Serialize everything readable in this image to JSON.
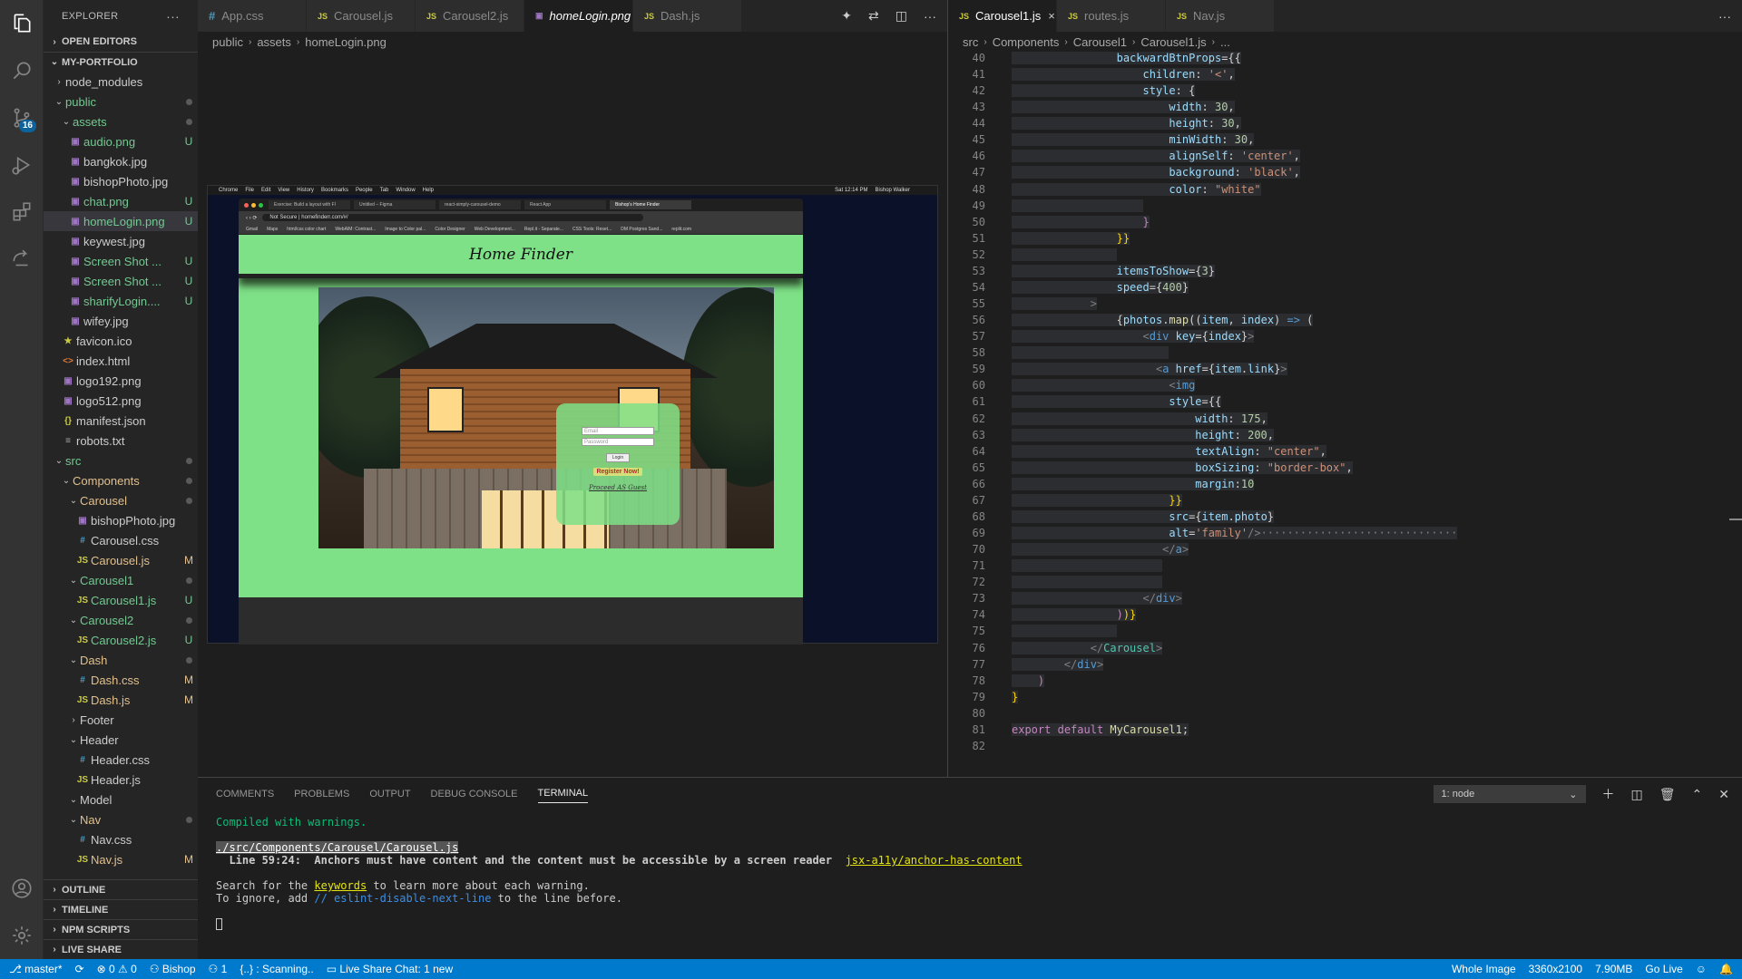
{
  "sidebar": {
    "title": "EXPLORER",
    "more": "···",
    "open_editors": "OPEN EDITORS",
    "project": "MY-PORTFOLIO",
    "tree": [
      {
        "depth": 1,
        "kind": "folder",
        "open": false,
        "label": "node_modules",
        "status": ""
      },
      {
        "depth": 1,
        "kind": "folder",
        "open": true,
        "label": "public",
        "status": "dot",
        "color": "green"
      },
      {
        "depth": 2,
        "kind": "folder",
        "open": true,
        "label": "assets",
        "status": "dot",
        "color": "green"
      },
      {
        "depth": 3,
        "kind": "img",
        "label": "audio.png",
        "status": "U",
        "color": "green"
      },
      {
        "depth": 3,
        "kind": "img",
        "label": "bangkok.jpg",
        "status": ""
      },
      {
        "depth": 3,
        "kind": "img",
        "label": "bishopPhoto.jpg",
        "status": ""
      },
      {
        "depth": 3,
        "kind": "img",
        "label": "chat.png",
        "status": "U",
        "color": "green"
      },
      {
        "depth": 3,
        "kind": "img",
        "label": "homeLogin.png",
        "status": "U",
        "color": "green",
        "selected": true
      },
      {
        "depth": 3,
        "kind": "img",
        "label": "keywest.jpg",
        "status": ""
      },
      {
        "depth": 3,
        "kind": "img",
        "label": "Screen Shot ...",
        "status": "U",
        "color": "green"
      },
      {
        "depth": 3,
        "kind": "img",
        "label": "Screen Shot ...",
        "status": "U",
        "color": "green"
      },
      {
        "depth": 3,
        "kind": "img",
        "label": "sharifyLogin....",
        "status": "U",
        "color": "green"
      },
      {
        "depth": 3,
        "kind": "img",
        "label": "wifey.jpg",
        "status": ""
      },
      {
        "depth": 2,
        "kind": "star",
        "label": "favicon.ico",
        "status": ""
      },
      {
        "depth": 2,
        "kind": "html",
        "label": "index.html",
        "status": ""
      },
      {
        "depth": 2,
        "kind": "img",
        "label": "logo192.png",
        "status": ""
      },
      {
        "depth": 2,
        "kind": "img",
        "label": "logo512.png",
        "status": ""
      },
      {
        "depth": 2,
        "kind": "json",
        "label": "manifest.json",
        "status": ""
      },
      {
        "depth": 2,
        "kind": "txt",
        "label": "robots.txt",
        "status": ""
      },
      {
        "depth": 1,
        "kind": "folder",
        "open": true,
        "label": "src",
        "status": "dot",
        "color": "green"
      },
      {
        "depth": 2,
        "kind": "folder",
        "open": true,
        "label": "Components",
        "status": "dot",
        "color": "yellow"
      },
      {
        "depth": 3,
        "kind": "folder",
        "open": true,
        "label": "Carousel",
        "status": "dot",
        "color": "yellow"
      },
      {
        "depth": 4,
        "kind": "img",
        "label": "bishopPhoto.jpg",
        "status": ""
      },
      {
        "depth": 4,
        "kind": "css",
        "label": "Carousel.css",
        "status": ""
      },
      {
        "depth": 4,
        "kind": "js",
        "label": "Carousel.js",
        "status": "M",
        "color": "yellow"
      },
      {
        "depth": 3,
        "kind": "folder",
        "open": true,
        "label": "Carousel1",
        "status": "dot",
        "color": "green"
      },
      {
        "depth": 4,
        "kind": "js",
        "label": "Carousel1.js",
        "status": "U",
        "color": "green"
      },
      {
        "depth": 3,
        "kind": "folder",
        "open": true,
        "label": "Carousel2",
        "status": "dot",
        "color": "green"
      },
      {
        "depth": 4,
        "kind": "js",
        "label": "Carousel2.js",
        "status": "U",
        "color": "green"
      },
      {
        "depth": 3,
        "kind": "folder",
        "open": true,
        "label": "Dash",
        "status": "dot",
        "color": "yellow"
      },
      {
        "depth": 4,
        "kind": "css",
        "label": "Dash.css",
        "status": "M",
        "color": "yellow"
      },
      {
        "depth": 4,
        "kind": "js",
        "label": "Dash.js",
        "status": "M",
        "color": "yellow"
      },
      {
        "depth": 3,
        "kind": "folder",
        "open": false,
        "label": "Footer",
        "status": ""
      },
      {
        "depth": 3,
        "kind": "folder",
        "open": true,
        "label": "Header",
        "status": ""
      },
      {
        "depth": 4,
        "kind": "css",
        "label": "Header.css",
        "status": ""
      },
      {
        "depth": 4,
        "kind": "js",
        "label": "Header.js",
        "status": ""
      },
      {
        "depth": 3,
        "kind": "folder",
        "open": true,
        "label": "Model",
        "status": ""
      },
      {
        "depth": 3,
        "kind": "folder",
        "open": true,
        "label": "Nav",
        "status": "dot",
        "color": "yellow"
      },
      {
        "depth": 4,
        "kind": "css",
        "label": "Nav.css",
        "status": ""
      },
      {
        "depth": 4,
        "kind": "js",
        "label": "Nav.js",
        "status": "M",
        "color": "yellow"
      }
    ],
    "bottom_sections": [
      "OUTLINE",
      "TIMELINE",
      "NPM SCRIPTS",
      "LIVE SHARE"
    ]
  },
  "editor_left": {
    "tabs": [
      {
        "icon": "#",
        "icon_kind": "css",
        "label": "App.css"
      },
      {
        "icon": "JS",
        "icon_kind": "js",
        "label": "Carousel.js"
      },
      {
        "icon": "JS",
        "icon_kind": "js",
        "label": "Carousel2.js"
      },
      {
        "icon": "▣",
        "icon_kind": "img",
        "label": "homeLogin.png",
        "active": true,
        "close": "×"
      },
      {
        "icon": "JS",
        "icon_kind": "js",
        "label": "Dash.js"
      }
    ],
    "breadcrumb": [
      "public",
      "assets",
      "homeLogin.png"
    ],
    "preview": {
      "mac_menu": [
        "Chrome",
        "File",
        "Edit",
        "View",
        "History",
        "Bookmarks",
        "People",
        "Tab",
        "Window",
        "Help",
        "Sat 12:14 PM",
        "Bishop Walker"
      ],
      "chrome_tabs": [
        "Exercise: Build a layout with Fl",
        "Untitled – Figma",
        "react-simply-carousel-demo",
        "React App",
        "Bishop's Home Finder"
      ],
      "address": "Not Secure | homefinderr.com/#/",
      "bookmarks": [
        "Gmail",
        "Maps",
        "html/css color chart",
        "WebAIM: Contrast...",
        "Image to Color pal...",
        "Color Designer",
        "Web Development...",
        "Repl.it - Separate...",
        "CSS Tools: Reset...",
        "DM Postgres Sand...",
        "replit.com"
      ],
      "site_title": "Home Finder",
      "email_ph": "Email",
      "password_ph": "Password",
      "login_btn": "Login",
      "register": "Register Now!",
      "guest": "Proceed AS Guest"
    }
  },
  "editor_right": {
    "tabs": [
      {
        "icon": "JS",
        "icon_kind": "js",
        "label": "Carousel1.js",
        "active": true,
        "close": "×"
      },
      {
        "icon": "JS",
        "icon_kind": "js",
        "label": "routes.js"
      },
      {
        "icon": "JS",
        "icon_kind": "js",
        "label": "Nav.js"
      }
    ],
    "breadcrumb": [
      "src",
      "Components",
      "Carousel1",
      "Carousel1.js",
      "..."
    ],
    "lines": [
      {
        "n": "40",
        "indent": 16,
        "html": "<span class='pp'>backwardBtnProps</span>={{"
      },
      {
        "n": "41",
        "indent": 20,
        "html": "<span class='pp'>children</span>: <span class='s'>'&lt;'</span>,"
      },
      {
        "n": "42",
        "indent": 20,
        "html": "<span class='pp'>style</span>: {"
      },
      {
        "n": "43",
        "indent": 24,
        "html": "<span class='pp'>width</span>: <span class='n'>30</span>,"
      },
      {
        "n": "44",
        "indent": 24,
        "html": "<span class='pp'>height</span>: <span class='n'>30</span>,"
      },
      {
        "n": "45",
        "indent": 24,
        "html": "<span class='pp'>minWidth</span>: <span class='n'>30</span>,"
      },
      {
        "n": "46",
        "indent": 24,
        "html": "<span class='pp'>alignSelf</span>: <span class='s'>'center'</span>,"
      },
      {
        "n": "47",
        "indent": 24,
        "html": "<span class='pp'>background</span>: <span class='s'>'black'</span>,"
      },
      {
        "n": "48",
        "indent": 24,
        "html": "<span class='pp'>color</span>: <span class='s'>\"white\"</span>"
      },
      {
        "n": "49",
        "indent": 0,
        "html": "                    "
      },
      {
        "n": "50",
        "indent": 20,
        "html": "<span class='pk'>}</span>"
      },
      {
        "n": "51",
        "indent": 16,
        "html": "<span class='y'>}}</span>"
      },
      {
        "n": "52",
        "indent": 0,
        "html": "                "
      },
      {
        "n": "53",
        "indent": 16,
        "html": "<span class='pp'>itemsToShow</span>={<span class='n'>3</span>}"
      },
      {
        "n": "54",
        "indent": 16,
        "html": "<span class='pp'>speed</span>={<span class='n'>400</span>}"
      },
      {
        "n": "55",
        "indent": 12,
        "html": "<span class='g'>&gt;</span>"
      },
      {
        "n": "56",
        "indent": 16,
        "html": "{<span class='pp'>photos</span>.<span class='f'>map</span>((<span class='pp'>item</span>, <span class='pp'>index</span>) <span class='k'>=&gt;</span> ("
      },
      {
        "n": "57",
        "indent": 20,
        "html": "<span class='g'>&lt;</span><span class='k'>div</span> <span class='pp'>key</span>={<span class='pp'>index</span>}<span class='g'>&gt;</span>"
      },
      {
        "n": "58",
        "indent": 0,
        "html": "                        "
      },
      {
        "n": "59",
        "indent": 22,
        "html": "<span class='g'>&lt;</span><span class='k'>a</span> <span class='pp'>href</span>={<span class='pp'>item</span>.<span class='pp'>link</span>}<span class='g'>&gt;</span>"
      },
      {
        "n": "60",
        "indent": 24,
        "html": "<span class='g'>&lt;</span><span class='k'>img</span>"
      },
      {
        "n": "61",
        "indent": 24,
        "html": "<span class='pp'>style</span>={{"
      },
      {
        "n": "62",
        "indent": 28,
        "html": "<span class='pp'>width</span>: <span class='n'>175</span>,"
      },
      {
        "n": "63",
        "indent": 28,
        "html": "<span class='pp'>height</span>: <span class='n'>200</span>,"
      },
      {
        "n": "64",
        "indent": 28,
        "html": "<span class='pp'>textAlign</span>: <span class='s'>\"center\"</span>,"
      },
      {
        "n": "65",
        "indent": 28,
        "html": "<span class='pp'>boxSizing</span>: <span class='s'>\"border-box\"</span>,"
      },
      {
        "n": "66",
        "indent": 28,
        "html": "<span class='pp'>margin</span>:<span class='n'>10</span>"
      },
      {
        "n": "67",
        "indent": 24,
        "html": "<span class='y'>}}</span>"
      },
      {
        "n": "68",
        "indent": 24,
        "html": "<span class='pp'>src</span>={<span class='pp'>item</span>.<span class='pp'>photo</span>}"
      },
      {
        "n": "69",
        "indent": 24,
        "html": "<span class='pp'>alt</span>=<span class='s'>'family'</span><span class='g'>/&gt;</span><span class='g'>······························</span>"
      },
      {
        "n": "70",
        "indent": 23,
        "html": "<span class='g'>&lt;/</span><span class='k'>a</span><span class='g'>&gt;</span>"
      },
      {
        "n": "71",
        "indent": 0,
        "html": "                       "
      },
      {
        "n": "72",
        "indent": 0,
        "html": "                       "
      },
      {
        "n": "73",
        "indent": 20,
        "html": "<span class='g'>&lt;/</span><span class='k'>div</span><span class='g'>&gt;</span>"
      },
      {
        "n": "74",
        "indent": 16,
        "html": "<span class='pk'>)</span><span class='y'>)}</span>"
      },
      {
        "n": "75",
        "indent": 0,
        "html": "                "
      },
      {
        "n": "76",
        "indent": 12,
        "html": "<span class='g'>&lt;/</span><span class='t'>Carousel</span><span class='g'>&gt;</span>"
      },
      {
        "n": "77",
        "indent": 8,
        "html": "<span class='g'>&lt;/</span><span class='k'>div</span><span class='g'>&gt;</span>"
      },
      {
        "n": "78",
        "indent": 4,
        "html": "<span class='pk'>)</span>"
      },
      {
        "n": "79",
        "indent": 0,
        "html": "<span class='y'>}</span>"
      },
      {
        "n": "80",
        "indent": 0,
        "html": ""
      },
      {
        "n": "81",
        "indent": 0,
        "html": "<span class='pk'>export</span> <span class='pk'>default</span> <span class='f'>MyCarousel1</span>;"
      },
      {
        "n": "82",
        "indent": 0,
        "html": ""
      }
    ]
  },
  "panel": {
    "tabs": [
      "COMMENTS",
      "PROBLEMS",
      "OUTPUT",
      "DEBUG CONSOLE",
      "TERMINAL"
    ],
    "active_tab": "TERMINAL",
    "terminal_select": "1: node",
    "terminal": {
      "compiled": "Compiled with warnings.",
      "file": "./src/Components/Carousel/Carousel.js",
      "line": "  Line 59:24:  Anchors must have content and the content must be accessible by a screen reader  ",
      "rule": "jsx-a11y/anchor-has-content",
      "search_pre": "Search for the ",
      "keywords": "keywords",
      "search_post": " to learn more about each warning.",
      "ignore_pre": "To ignore, add ",
      "ignore_code": "// eslint-disable-next-line",
      "ignore_post": " to the line before."
    }
  },
  "status": {
    "branch": "master*",
    "sync": "⟳",
    "errors": "⊗ 0 ⚠ 0",
    "liveshare_user": "Bishop",
    "count": "1",
    "scanning": "{..} : Scanning..",
    "chat": "Live Share Chat: 1 new",
    "right": [
      "Whole Image",
      "3360x2100",
      "7.90MB",
      "Go Live"
    ]
  },
  "activity_badge": "16"
}
